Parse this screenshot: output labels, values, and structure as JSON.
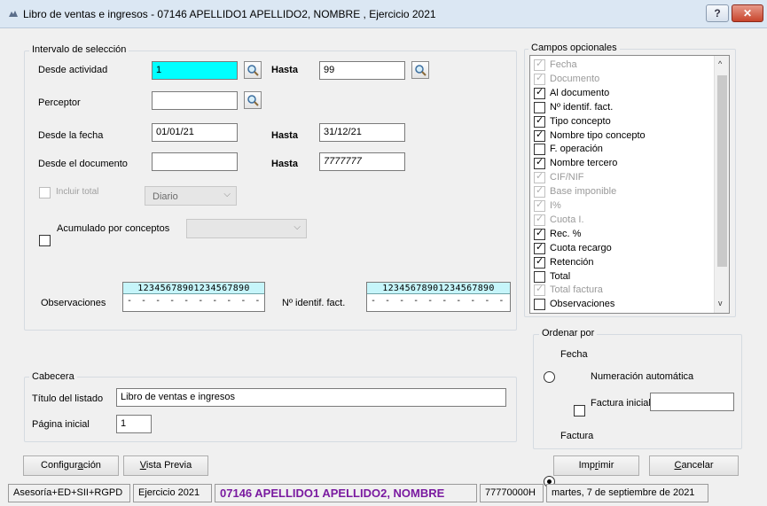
{
  "window": {
    "title": "Libro de ventas e ingresos - 07146 APELLIDO1 APELLIDO2, NOMBRE , Ejercicio 2021",
    "help_button": "?",
    "close_button": "✕"
  },
  "seleccion": {
    "legend": "Intervalo de selección",
    "desde_actividad": {
      "label": "Desde actividad",
      "value": "1"
    },
    "hasta_actividad": {
      "label": "Hasta",
      "value": "99"
    },
    "perceptor": {
      "label": "Perceptor",
      "value": ""
    },
    "desde_fecha": {
      "label": "Desde la fecha",
      "value": "01/01/21"
    },
    "hasta_fecha": {
      "label": "Hasta",
      "value": "31/12/21"
    },
    "desde_documento": {
      "label": "Desde el documento",
      "value": ""
    },
    "hasta_documento": {
      "label": "Hasta",
      "value": "7777777"
    },
    "incluir_total": {
      "label": "Incluir total",
      "checked": false
    },
    "periodo_combo": {
      "value": "Diario"
    },
    "acumulado": {
      "label": "Acumulado por conceptos",
      "checked": false
    },
    "conceptos_combo": {
      "value": ""
    },
    "observaciones": {
      "label": "Observaciones",
      "ruler": "12345678901234567890",
      "value": "- - - - - - - - - - - - - - - - - - - -"
    },
    "n_identif": {
      "label": "Nº identif. fact.",
      "ruler": "12345678901234567890",
      "value": "- - - - - - - - - - - - - - - - - - - -"
    }
  },
  "campos": {
    "legend": "Campos opcionales",
    "items": [
      {
        "label": "Fecha",
        "checked": true,
        "enabled": false
      },
      {
        "label": "Documento",
        "checked": true,
        "enabled": false
      },
      {
        "label": "Al documento",
        "checked": true,
        "enabled": true
      },
      {
        "label": "Nº identif. fact.",
        "checked": false,
        "enabled": true
      },
      {
        "label": "Tipo concepto",
        "checked": true,
        "enabled": true
      },
      {
        "label": "Nombre tipo concepto",
        "checked": true,
        "enabled": true
      },
      {
        "label": "F. operación",
        "checked": false,
        "enabled": true
      },
      {
        "label": "Nombre tercero",
        "checked": true,
        "enabled": true
      },
      {
        "label": "CIF/NIF",
        "checked": true,
        "enabled": false
      },
      {
        "label": "Base imponible",
        "checked": true,
        "enabled": false
      },
      {
        "label": "I%",
        "checked": true,
        "enabled": false
      },
      {
        "label": "Cuota I.",
        "checked": true,
        "enabled": false
      },
      {
        "label": "Rec. %",
        "checked": true,
        "enabled": true
      },
      {
        "label": "Cuota recargo",
        "checked": true,
        "enabled": true
      },
      {
        "label": "Retención",
        "checked": true,
        "enabled": true
      },
      {
        "label": "Total",
        "checked": false,
        "enabled": true
      },
      {
        "label": "Total factura",
        "checked": true,
        "enabled": false
      },
      {
        "label": "Observaciones",
        "checked": false,
        "enabled": true
      }
    ]
  },
  "cabecera": {
    "legend": "Cabecera",
    "titulo": {
      "label": "Título del listado",
      "value": "Libro de ventas e ingresos"
    },
    "pagina": {
      "label": "Página inicial",
      "value": "1"
    }
  },
  "ordenar": {
    "legend": "Ordenar por",
    "fecha": {
      "label": "Fecha",
      "selected": false
    },
    "numeracion": {
      "label": "Numeración automática",
      "checked": false
    },
    "factura_inicial": {
      "label": "Factura inicial",
      "value": ""
    },
    "factura": {
      "label": "Factura",
      "selected": true
    }
  },
  "buttons": {
    "configuracion": "Configuración",
    "vista_previa": "Vista Previa",
    "imprimir": "Imprimir",
    "cancelar": "Cancelar"
  },
  "statusbar": {
    "product": "Asesoría+ED+SII+RGPD",
    "ejercicio": "Ejercicio 2021",
    "company": "07146 APELLIDO1 APELLIDO2, NOMBRE",
    "nif": "77770000H",
    "date": "martes, 7 de septiembre de 2021"
  },
  "colors": {
    "highlight_input": "#00ffff",
    "company_text": "#7a1aa0",
    "ruler_bg": "#c6f5fa",
    "titlebar_bg": "#dbe7f3"
  }
}
